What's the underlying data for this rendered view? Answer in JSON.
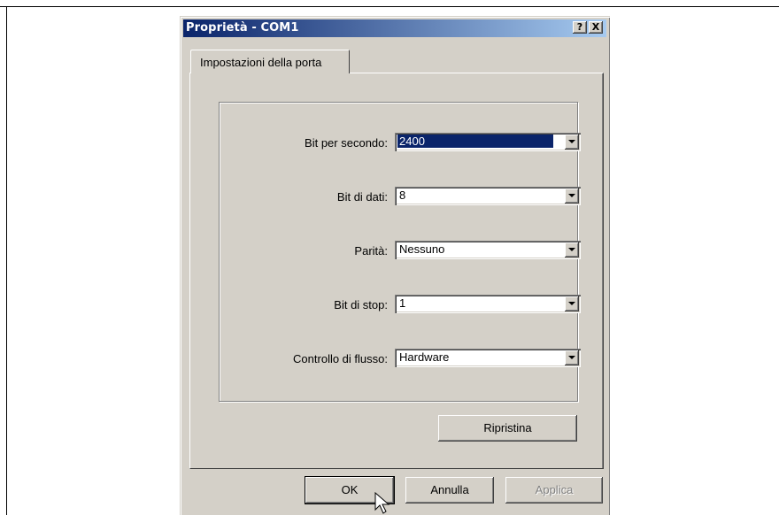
{
  "dialog": {
    "title": "Proprietà - COM1",
    "help_glyph": "?",
    "close_glyph": "X"
  },
  "tabs": [
    {
      "label": "Impostazioni della porta",
      "selected": true
    }
  ],
  "settings": [
    {
      "label": "Bit per secondo:",
      "value": "2400",
      "selected": true
    },
    {
      "label": "Bit di dati:",
      "value": "8",
      "selected": false
    },
    {
      "label": "Parità:",
      "value": "Nessuno",
      "selected": false
    },
    {
      "label": "Bit di stop:",
      "value": "1",
      "selected": false
    },
    {
      "label": "Controllo di flusso:",
      "value": "Hardware",
      "selected": false
    }
  ],
  "buttons": {
    "restore": "Ripristina",
    "ok": "OK",
    "cancel": "Annulla",
    "apply": "Applica"
  },
  "colors": {
    "titlebar_start": "#0a246a",
    "titlebar_end": "#a6caf0",
    "face": "#d4d0c8",
    "selection": "#0a246a"
  },
  "icons": {
    "cursor": "mouse-pointer-icon",
    "dropdown": "chevron-down-icon"
  }
}
